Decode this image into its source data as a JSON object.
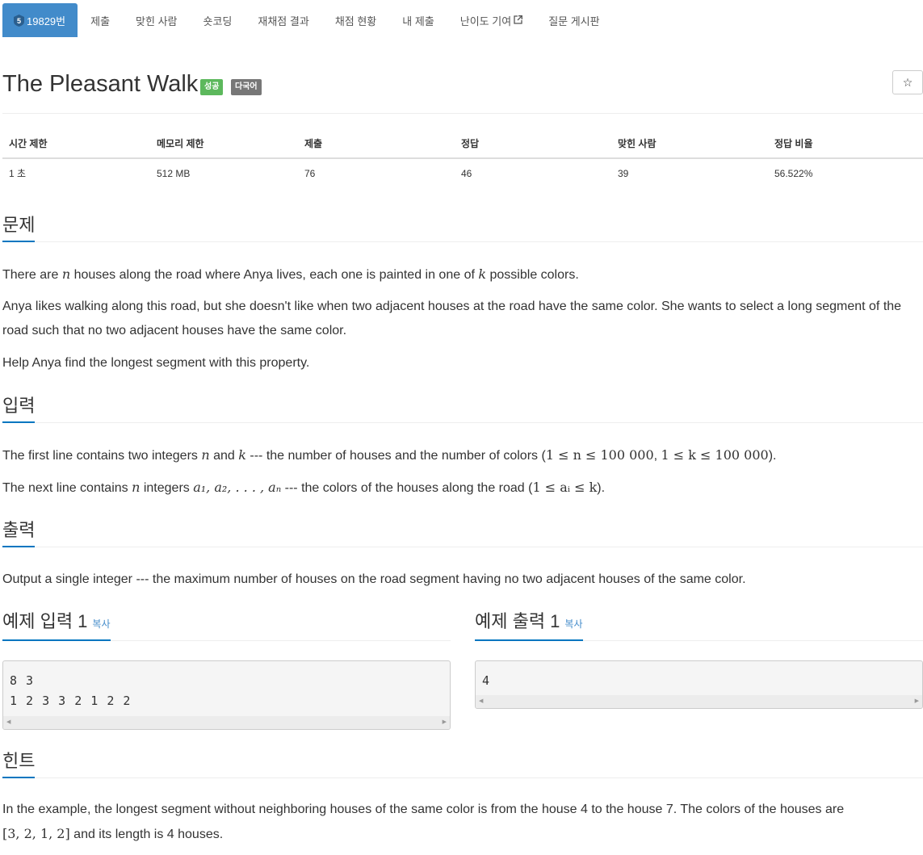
{
  "nav": {
    "problem_id": "19829번",
    "tier_number": "5",
    "items": [
      "제출",
      "맞힌 사람",
      "숏코딩",
      "재채점 결과",
      "채점 현황",
      "내 제출",
      "난이도 기여",
      "질문 게시판"
    ]
  },
  "title": {
    "text": "The Pleasant Walk",
    "badge_status": "성공",
    "badge_lang": "다국어",
    "star": "☆"
  },
  "info": {
    "headers": [
      "시간 제한",
      "메모리 제한",
      "제출",
      "정답",
      "맞힌 사람",
      "정답 비율"
    ],
    "values": [
      "1 초",
      "512 MB",
      "76",
      "46",
      "39",
      "56.522%"
    ]
  },
  "problem": {
    "heading": "문제",
    "p1_a": "There are ",
    "p1_n": "n",
    "p1_b": " houses along the road where Anya lives, each one is painted in one of ",
    "p1_k": "k",
    "p1_c": " possible colors.",
    "p2": "Anya likes walking along this road, but she doesn't like when two adjacent houses at the road have the same color. She wants to select a long segment of the road such that no two adjacent houses have the same color.",
    "p3": "Help Anya find the longest segment with this property."
  },
  "input": {
    "heading": "입력",
    "l1_a": "The first line contains two integers ",
    "l1_n": "n",
    "l1_b": " and ",
    "l1_k": "k",
    "l1_c": " --- the number of houses and the number of colors (",
    "l1_math1": "1 ≤ n ≤ 100 000",
    "l1_comma": ", ",
    "l1_math2": "1 ≤ k ≤ 100 000",
    "l1_d": ").",
    "l2_a": "The next line contains ",
    "l2_n": "n",
    "l2_b": " integers ",
    "l2_seq": "a₁, a₂, . . . , aₙ",
    "l2_c": " --- the colors of the houses along the road (",
    "l2_math": "1 ≤ aᵢ ≤ k",
    "l2_d": ")."
  },
  "output": {
    "heading": "출력",
    "text": "Output a single integer --- the maximum number of houses on the road segment having no two adjacent houses of the same color."
  },
  "samples": {
    "input_heading": "예제 입력 1",
    "output_heading": "예제 출력 1",
    "copy_label": "복사",
    "input_text": "8 3\n1 2 3 3 2 1 2 2",
    "output_text": "4"
  },
  "hint": {
    "heading": "힌트",
    "l1": "In the example, the longest segment without neighboring houses of the same color is from the house 4 to the house 7. The colors of the houses are",
    "l2_math": "[3, 2, 1, 2]",
    "l2_rest": " and its length is 4 houses."
  }
}
